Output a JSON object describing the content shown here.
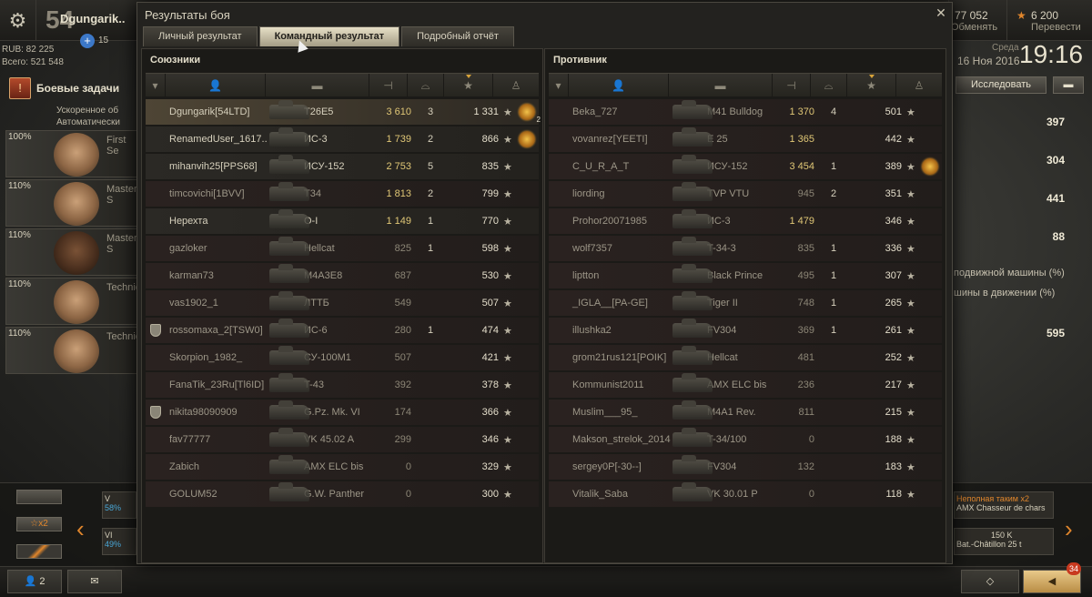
{
  "header": {
    "level": "54",
    "player_name": "Dgungarik..",
    "premium_count": "15",
    "rub_line": "RUB: 82 225",
    "total_line": "Всего: 521 548",
    "tasks_label": "Боевые задачи",
    "gold": "6 200",
    "credits": "77 052",
    "exchange_label": "Обменять",
    "transfer_label": "Перевести",
    "date_label": "Среда",
    "date": "16 Ноя 2016",
    "time": "19:16",
    "research_label": "Исследовать"
  },
  "crew": [
    {
      "pct": "100%",
      "role": "First Se"
    },
    {
      "pct": "110%",
      "role": "Master S"
    },
    {
      "pct": "110%",
      "role": "Master S"
    },
    {
      "pct": "110%",
      "role": "Technica"
    },
    {
      "pct": "110%",
      "role": "Technica"
    }
  ],
  "crew_top": {
    "line1": "Ускоренное об",
    "line2": "Автоматически"
  },
  "right_stats": {
    "v1": "397",
    "v2": "304",
    "v3": "441",
    "v4": "88",
    "v5": "595",
    "text1": "подвижной машины (%)",
    "text2": "шины в движении (%)"
  },
  "bottom": {
    "multiplier": "x2",
    "squad_count": "2",
    "notif_count": "34",
    "event1": "Неполная таким",
    "event1_sub": "AMX Chasseur de chars",
    "event1_mult": "x2",
    "event2_price": "150 K",
    "event2_sub": "Bat.-Châtillon 25 t",
    "prog1": "58%",
    "prog2": "49%",
    "tier1": "V",
    "tier2": "VI"
  },
  "dialog": {
    "title": "Результаты боя",
    "tabs": [
      "Личный результат",
      "Командный результат",
      "Подробный отчёт"
    ],
    "active_tab": 1,
    "allies_title": "Союзники",
    "enemies_title": "Противник"
  },
  "allies": [
    {
      "name": "Dgungarik[54LTD]",
      "tank": "T26E5",
      "dmg": "3 610",
      "kills": "3",
      "xp": "1 331",
      "self": true,
      "alive": true,
      "medal": true,
      "medal_count": "2",
      "shield": false
    },
    {
      "name": "RenamedUser_1617..",
      "tank": "ИС-3",
      "dmg": "1 739",
      "kills": "2",
      "xp": "866",
      "alive": true,
      "medal": true,
      "shield": false
    },
    {
      "name": "mihanvih25[PPS68]",
      "tank": "ИСУ-152",
      "dmg": "2 753",
      "kills": "5",
      "xp": "835",
      "alive": true,
      "shield": false
    },
    {
      "name": "timcovichi[1BVV]",
      "tank": "T34",
      "dmg": "1 813",
      "kills": "2",
      "xp": "799",
      "alive": false,
      "shield": false
    },
    {
      "name": "Нерехта",
      "tank": "O-I",
      "dmg": "1 149",
      "kills": "1",
      "xp": "770",
      "alive": true,
      "shield": false
    },
    {
      "name": "gazloker",
      "tank": "Hellcat",
      "dmg": "825",
      "kills": "1",
      "xp": "598",
      "alive": false,
      "shield": false
    },
    {
      "name": "karman73",
      "tank": "M4A3E8",
      "dmg": "687",
      "kills": "",
      "xp": "530",
      "alive": false,
      "shield": false
    },
    {
      "name": "vas1902_1",
      "tank": "ЛТТБ",
      "dmg": "549",
      "kills": "",
      "xp": "507",
      "alive": false,
      "shield": false
    },
    {
      "name": "rossomaxa_2[TSW0]",
      "tank": "ИС-6",
      "dmg": "280",
      "kills": "1",
      "xp": "474",
      "alive": false,
      "shield": true
    },
    {
      "name": "Skorpion_1982_",
      "tank": "СУ-100М1",
      "dmg": "507",
      "kills": "",
      "xp": "421",
      "alive": false,
      "shield": false
    },
    {
      "name": "FanaTik_23Ru[Tl6ID]",
      "tank": "T-43",
      "dmg": "392",
      "kills": "",
      "xp": "378",
      "alive": false,
      "shield": false
    },
    {
      "name": "nikita98090909",
      "tank": "G.Pz. Mk. VI",
      "dmg": "174",
      "kills": "",
      "xp": "366",
      "alive": false,
      "shield": true
    },
    {
      "name": "fav77777",
      "tank": "VK 45.02 A",
      "dmg": "299",
      "kills": "",
      "xp": "346",
      "alive": false,
      "shield": false
    },
    {
      "name": "Zabich",
      "tank": "AMX ELC bis",
      "dmg": "0",
      "kills": "",
      "xp": "329",
      "alive": false,
      "shield": false
    },
    {
      "name": "GOLUM52",
      "tank": "G.W. Panther",
      "dmg": "0",
      "kills": "",
      "xp": "300",
      "alive": false,
      "shield": false
    }
  ],
  "enemies": [
    {
      "name": "Beka_727",
      "tank": "M41 Bulldog",
      "dmg": "1 370",
      "kills": "4",
      "xp": "501",
      "alive": false
    },
    {
      "name": "vovanrez[YEETI]",
      "tank": "E 25",
      "dmg": "1 365",
      "kills": "",
      "xp": "442",
      "alive": false
    },
    {
      "name": "C_U_R_A_T",
      "tank": "ИСУ-152",
      "dmg": "3 454",
      "kills": "1",
      "xp": "389",
      "alive": false,
      "medal": true
    },
    {
      "name": "liording",
      "tank": "TVP VTU",
      "dmg": "945",
      "kills": "2",
      "xp": "351",
      "alive": false
    },
    {
      "name": "Prohor20071985",
      "tank": "ИС-3",
      "dmg": "1 479",
      "kills": "",
      "xp": "346",
      "alive": false
    },
    {
      "name": "wolf7357",
      "tank": "T-34-3",
      "dmg": "835",
      "kills": "1",
      "xp": "336",
      "alive": false
    },
    {
      "name": "liptton",
      "tank": "Black Prince",
      "dmg": "495",
      "kills": "1",
      "xp": "307",
      "alive": false
    },
    {
      "name": "_IGLA__[PA-GE]",
      "tank": "Tiger II",
      "dmg": "748",
      "kills": "1",
      "xp": "265",
      "alive": false
    },
    {
      "name": "illushka2",
      "tank": "FV304",
      "dmg": "369",
      "kills": "1",
      "xp": "261",
      "alive": false
    },
    {
      "name": "grom21rus121[POIK]",
      "tank": "Hellcat",
      "dmg": "481",
      "kills": "",
      "xp": "252",
      "alive": false
    },
    {
      "name": "Kommunist2011",
      "tank": "AMX ELC bis",
      "dmg": "236",
      "kills": "",
      "xp": "217",
      "alive": false
    },
    {
      "name": "Muslim___95_",
      "tank": "M4A1 Rev.",
      "dmg": "811",
      "kills": "",
      "xp": "215",
      "alive": false
    },
    {
      "name": "Makson_strelok_2014",
      "tank": "T-34/100",
      "dmg": "0",
      "kills": "",
      "xp": "188",
      "alive": false
    },
    {
      "name": "sergey0P[-30--]",
      "tank": "FV304",
      "dmg": "132",
      "kills": "",
      "xp": "183",
      "alive": false
    },
    {
      "name": "Vitalik_Saba",
      "tank": "VK 30.01 P",
      "dmg": "0",
      "kills": "",
      "xp": "118",
      "alive": false
    }
  ]
}
